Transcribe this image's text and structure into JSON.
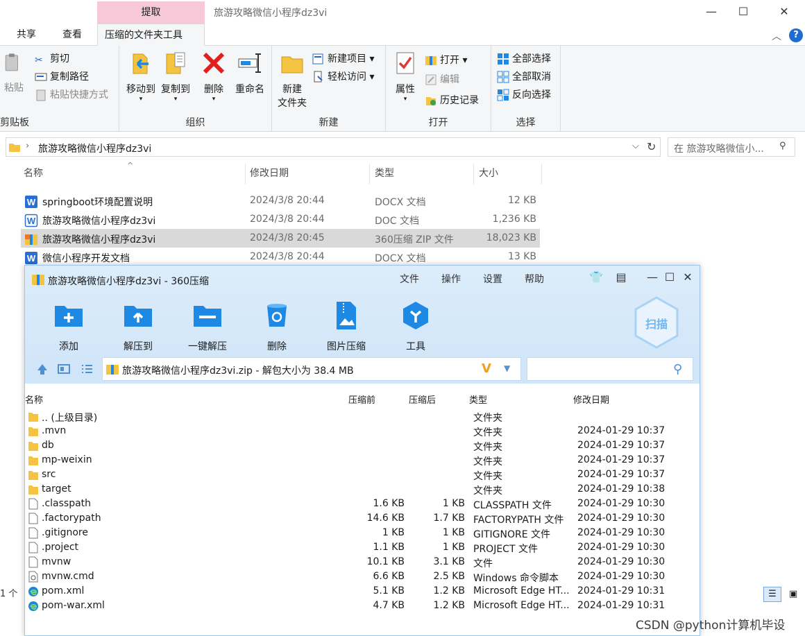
{
  "explorer": {
    "context_tab": "提取",
    "title": "旅游攻略微信小程序dz3vi",
    "tabs": [
      "共享",
      "查看",
      "压缩的文件夹工具"
    ],
    "ribbon": {
      "clipboard": {
        "paste": "粘贴",
        "cut": "剪切",
        "copy_path": "复制路径",
        "paste_shortcut": "粘贴快捷方式",
        "label": "剪贴板"
      },
      "organize": {
        "move_to": "移动到",
        "copy_to": "复制到",
        "delete": "删除",
        "rename": "重命名",
        "label": "组织"
      },
      "new": {
        "new_folder_1": "新建",
        "new_folder_2": "文件夹",
        "new_item": "新建项目",
        "easy_access": "轻松访问",
        "label": "新建"
      },
      "open": {
        "properties": "属性",
        "open": "打开",
        "edit": "编辑",
        "history": "历史记录",
        "label": "打开"
      },
      "select": {
        "select_all": "全部选择",
        "select_none": "全部取消",
        "invert": "反向选择",
        "label": "选择"
      }
    },
    "address": "旅游攻略微信小程序dz3vi",
    "search_placeholder": "在 旅游攻略微信小...",
    "columns": {
      "name": "名称",
      "date": "修改日期",
      "type": "类型",
      "size": "大小"
    },
    "files": [
      {
        "name": "springboot环境配置说明",
        "date": "2024/3/8 20:44",
        "type": "DOCX 文档",
        "size": "12 KB",
        "icon": "word-icon"
      },
      {
        "name": "旅游攻略微信小程序dz3vi",
        "date": "2024/3/8 20:44",
        "type": "DOC 文档",
        "size": "1,236 KB",
        "icon": "word-outline-icon"
      },
      {
        "name": "旅游攻略微信小程序dz3vi",
        "date": "2024/3/8 20:45",
        "type": "360压缩 ZIP 文件",
        "size": "18,023 KB",
        "icon": "zip-icon"
      },
      {
        "name": "微信小程序开发文档",
        "date": "2024/3/8 20:44",
        "type": "DOCX 文档",
        "size": "13 KB",
        "icon": "word-icon"
      }
    ],
    "selected_index": 2,
    "status": "1 个"
  },
  "zip": {
    "title": "旅游攻略微信小程序dz3vi - 360压缩",
    "menu": [
      "文件",
      "操作",
      "设置",
      "帮助"
    ],
    "tools": [
      "添加",
      "解压到",
      "一键解压",
      "删除",
      "图片压缩",
      "工具"
    ],
    "scan": "扫描",
    "path": "旅游攻略微信小程序dz3vi.zip - 解包大小为 38.4 MB",
    "columns": {
      "name": "名称",
      "before": "压缩前",
      "after": "压缩后",
      "type": "类型",
      "date": "修改日期"
    },
    "entries": [
      {
        "name": ".. (上级目录)",
        "before": "",
        "after": "",
        "type": "文件夹",
        "date": "",
        "icon": "folder-icon"
      },
      {
        "name": ".mvn",
        "before": "",
        "after": "",
        "type": "文件夹",
        "date": "2024-01-29 10:37",
        "icon": "folder-icon"
      },
      {
        "name": "db",
        "before": "",
        "after": "",
        "type": "文件夹",
        "date": "2024-01-29 10:37",
        "icon": "folder-icon"
      },
      {
        "name": "mp-weixin",
        "before": "",
        "after": "",
        "type": "文件夹",
        "date": "2024-01-29 10:37",
        "icon": "folder-icon"
      },
      {
        "name": "src",
        "before": "",
        "after": "",
        "type": "文件夹",
        "date": "2024-01-29 10:37",
        "icon": "folder-icon"
      },
      {
        "name": "target",
        "before": "",
        "after": "",
        "type": "文件夹",
        "date": "2024-01-29 10:38",
        "icon": "folder-icon"
      },
      {
        "name": ".classpath",
        "before": "1.6 KB",
        "after": "1 KB",
        "type": "CLASSPATH 文件",
        "date": "2024-01-29 10:30",
        "icon": "file-icon"
      },
      {
        "name": ".factorypath",
        "before": "14.6 KB",
        "after": "1.7 KB",
        "type": "FACTORYPATH 文件",
        "date": "2024-01-29 10:30",
        "icon": "file-icon"
      },
      {
        "name": ".gitignore",
        "before": "1 KB",
        "after": "1 KB",
        "type": "GITIGNORE 文件",
        "date": "2024-01-29 10:30",
        "icon": "file-icon"
      },
      {
        "name": ".project",
        "before": "1.1 KB",
        "after": "1 KB",
        "type": "PROJECT 文件",
        "date": "2024-01-29 10:30",
        "icon": "file-icon"
      },
      {
        "name": "mvnw",
        "before": "10.1 KB",
        "after": "3.1 KB",
        "type": "文件",
        "date": "2024-01-29 10:30",
        "icon": "file-icon"
      },
      {
        "name": "mvnw.cmd",
        "before": "6.6 KB",
        "after": "2.5 KB",
        "type": "Windows 命令脚本",
        "date": "2024-01-29 10:30",
        "icon": "cmd-script-icon"
      },
      {
        "name": "pom.xml",
        "before": "5.1 KB",
        "after": "1.2 KB",
        "type": "Microsoft Edge HT...",
        "date": "2024-01-29 10:31",
        "icon": "edge-icon"
      },
      {
        "name": "pom-war.xml",
        "before": "4.7 KB",
        "after": "1.2 KB",
        "type": "Microsoft Edge HT...",
        "date": "2024-01-29 10:31",
        "icon": "edge-icon"
      }
    ]
  },
  "watermark": "CSDN @python计算机毕设",
  "colors": {
    "context_tab": "#f7c8d8",
    "zip_header": "#dcecfb",
    "accent_blue": "#1e88e5",
    "selection": "#d9d9d9"
  }
}
